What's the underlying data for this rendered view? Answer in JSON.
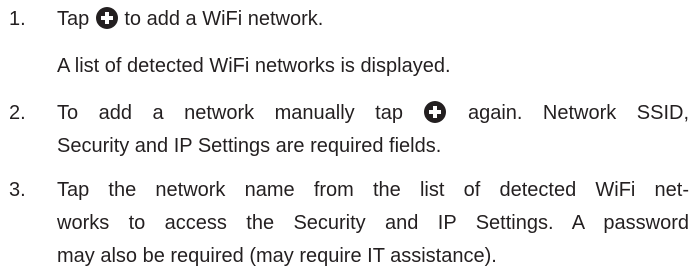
{
  "steps": [
    {
      "number": "1.",
      "before_icon": "Tap ",
      "icon": "plus-circle-icon",
      "after_icon": " to add a WiFi network.",
      "note": "A list of detected WiFi networks is displayed."
    },
    {
      "number": "2.",
      "before_icon": "To add a network manually tap ",
      "icon": "plus-circle-icon",
      "after_icon": " again. Network SSID,",
      "line2": "Security and IP Settings are required fields."
    },
    {
      "number": "3.",
      "line1": "Tap the network name from the list of detected WiFi net-",
      "line2": "works to access the Security and IP Settings. A password",
      "line3": "may also be required (may require IT assistance)."
    }
  ],
  "colors": {
    "text": "#231f20",
    "icon_fill": "#231f20",
    "icon_glyph": "#ffffff"
  }
}
